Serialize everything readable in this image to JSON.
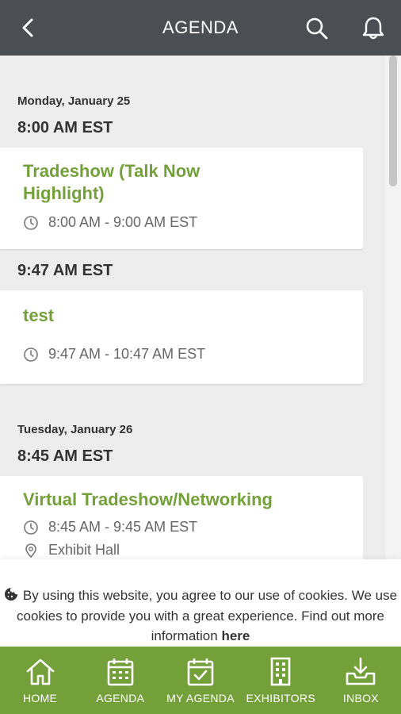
{
  "header": {
    "title": "AGENDA"
  },
  "days": [
    {
      "label": "Monday, January 25",
      "groups": [
        {
          "time": "8:00 AM EST",
          "event": {
            "title": "Tradeshow (Talk Now Highlight)",
            "time_range": "8:00 AM - 9:00 AM EST"
          }
        },
        {
          "time": "9:47 AM EST",
          "event": {
            "title": "test",
            "time_range": "9:47 AM - 10:47 AM EST"
          }
        }
      ]
    },
    {
      "label": "Tuesday, January 26",
      "groups": [
        {
          "time": "8:45 AM EST",
          "event": {
            "title": "Virtual Tradeshow/Networking",
            "time_range": "8:45 AM - 9:45 AM EST",
            "location": "Exhibit Hall"
          }
        }
      ]
    }
  ],
  "cookie": {
    "text": "By using this website, you agree to our use of cookies. We use cookies to provide you with a great experience. Find out more information",
    "link": "here"
  },
  "nav": [
    {
      "label": "HOME",
      "icon": "home-icon"
    },
    {
      "label": "AGENDA",
      "icon": "calendar-icon"
    },
    {
      "label": "MY AGENDA",
      "icon": "calendar-check-icon"
    },
    {
      "label": "EXHIBITORS",
      "icon": "building-icon"
    },
    {
      "label": "INBOX",
      "icon": "inbox-icon"
    }
  ],
  "colors": {
    "header_bg": "#4b4f54",
    "accent": "#74a03a",
    "background": "#ededed"
  }
}
